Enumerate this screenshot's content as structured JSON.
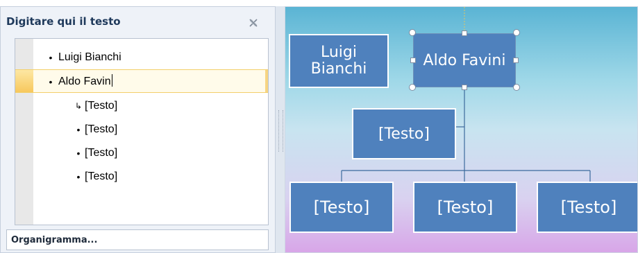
{
  "text_pane": {
    "title": "Digitare qui il testo",
    "close_icon": "close-x-icon",
    "items": [
      {
        "text": "Luigi Bianchi",
        "level": 0,
        "marker": "•"
      },
      {
        "text": "Aldo Favin",
        "level": 0,
        "marker": "•",
        "selected": true
      },
      {
        "text": "[Testo]",
        "level": 1,
        "marker": "↳"
      },
      {
        "text": "[Testo]",
        "level": 1,
        "marker": "•"
      },
      {
        "text": "[Testo]",
        "level": 1,
        "marker": "•"
      },
      {
        "text": "[Testo]",
        "level": 1,
        "marker": "•"
      }
    ],
    "footer_label": "Organigramma..."
  },
  "diagram": {
    "assistant_box": {
      "line1": "Luigi",
      "line2": "Bianchi"
    },
    "top_box": {
      "text": "Aldo Favini"
    },
    "middle_box": {
      "text": "[Testo]"
    },
    "bottom_boxes": [
      "[Testo]",
      "[Testo]",
      "[Testo]"
    ]
  },
  "colors": {
    "shape_fill": "#4f81bd",
    "shape_text": "#ffffff",
    "selection_highlight": "#fffbea",
    "title_text": "#1e395b"
  }
}
